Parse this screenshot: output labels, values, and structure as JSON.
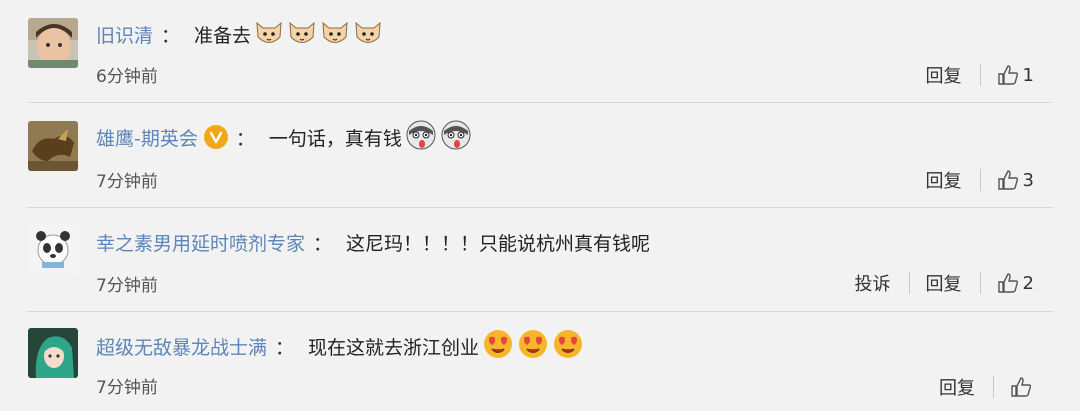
{
  "comments": [
    {
      "username": "旧识清",
      "text": "准备去",
      "emoji_count": 4,
      "emoji": "cat-face-icon",
      "time": "6分钟前",
      "reply_label": "回复",
      "likes": "1",
      "verified": false
    },
    {
      "username": "雄鹰-期英会",
      "text": "一句话，真有钱",
      "emoji_count": 2,
      "emoji": "husky-tongue-icon",
      "time": "7分钟前",
      "reply_label": "回复",
      "likes": "3",
      "verified": true
    },
    {
      "username": "幸之素男用延时喷剂专家",
      "text": "这尼玛！！！！只能说杭州真有钱呢",
      "emoji_count": 0,
      "time": "7分钟前",
      "report_label": "投诉",
      "reply_label": "回复",
      "likes": "2",
      "verified": false
    },
    {
      "username": "超级无敌暴龙战士满",
      "text": "现在这就去浙江创业",
      "emoji_count": 3,
      "emoji": "heart-eyes-icon",
      "time": "7分钟前",
      "reply_label": "回复",
      "likes": "",
      "verified": false
    }
  ],
  "colon": "：",
  "colors": {
    "username": "#5c86b8",
    "background": "#f2f2f2",
    "verified_badge": "#f0a81a",
    "heart_eyes": "#e8433d"
  }
}
